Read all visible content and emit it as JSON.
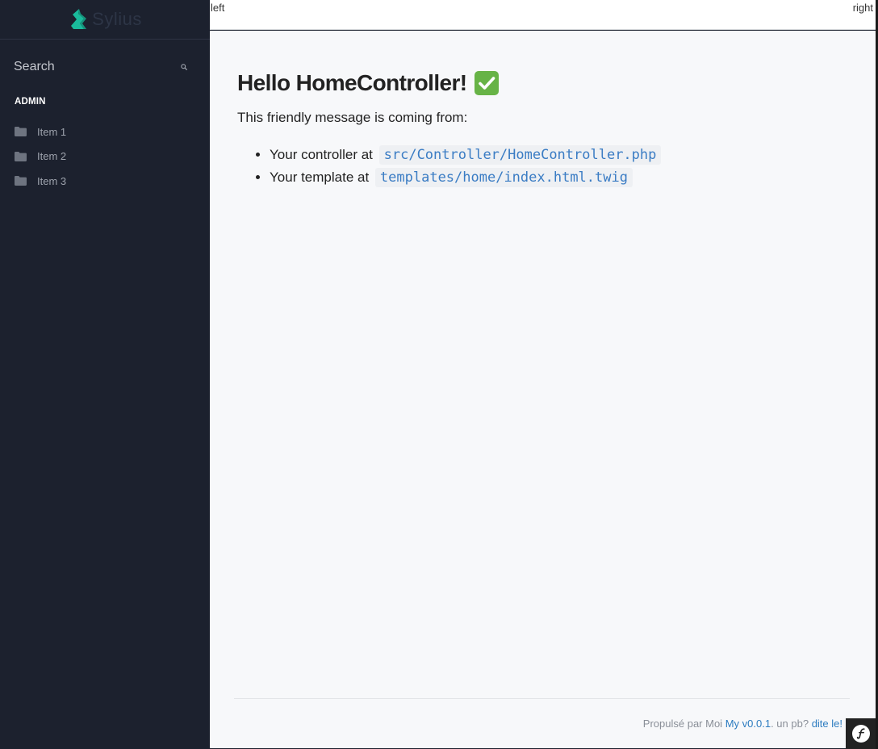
{
  "sidebar": {
    "brand_name": "Sylius",
    "search_placeholder": "Search",
    "section_header": "ADMIN",
    "items": [
      {
        "label": "Item 1",
        "icon": "folder-icon"
      },
      {
        "label": "Item 2",
        "icon": "folder-icon"
      },
      {
        "label": "Item 3",
        "icon": "folder-icon"
      }
    ]
  },
  "topbar": {
    "left": "left",
    "right": "right"
  },
  "main": {
    "title": "Hello HomeController!",
    "title_icon": "check-mark-icon",
    "intro": "This friendly message is coming from:",
    "items": [
      {
        "prefix": "Your controller at",
        "code": "src/Controller/HomeController.php"
      },
      {
        "prefix": "Your template at",
        "code": "templates/home/index.html.twig"
      }
    ]
  },
  "footer": {
    "prefix": "Propulsé par Moi",
    "version_link": "My v0.0.1",
    "middle": ". un pb?",
    "help_link": "dite le!"
  },
  "colors": {
    "sidebar_bg": "#1c212e",
    "brand_accent": "#1abb9c",
    "link": "#3a7cc4",
    "content_bg": "#f7f8fa"
  }
}
